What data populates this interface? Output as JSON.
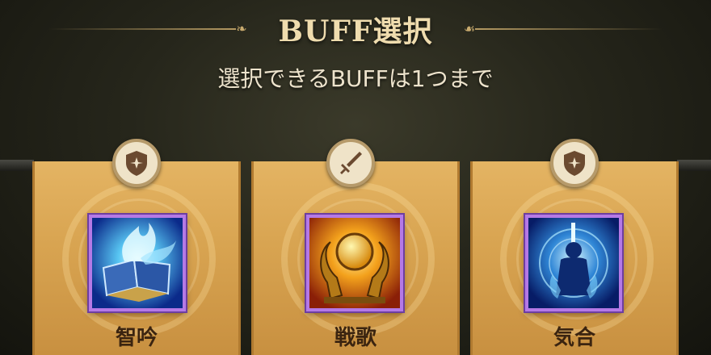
{
  "header": {
    "title": "BUFF選択",
    "subtitle": "選択できるBUFFは1つまで"
  },
  "buffs": [
    {
      "name": "智吟",
      "badge_icon": "shield-star-icon",
      "art": "glowing-book-art"
    },
    {
      "name": "戦歌",
      "badge_icon": "sword-icon",
      "art": "golden-dragon-orb-art"
    },
    {
      "name": "気合",
      "badge_icon": "shield-star-icon",
      "art": "blue-warrior-aura-art"
    }
  ],
  "colors": {
    "card_gold": "#d9a552",
    "frame_purple": "#b579e6",
    "title_text": "#efdcae",
    "name_text": "#3b2410"
  }
}
